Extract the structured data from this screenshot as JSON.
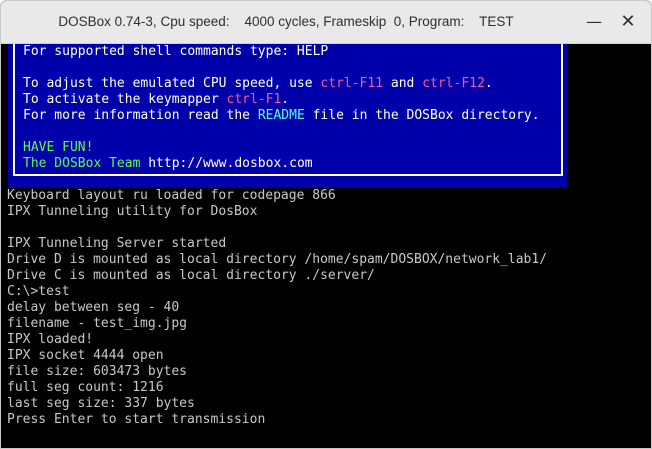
{
  "window": {
    "title": "DOSBox 0.74-3, Cpu speed:    4000 cycles, Frameskip  0, Program:    TEST",
    "minimize_glyph": "—",
    "close_glyph": "✕"
  },
  "banner": {
    "line1": "For supported shell commands type: HELP",
    "line2_a": "To adjust the emulated CPU speed, use ",
    "line2_k1": "ctrl-F11",
    "line2_b": " and ",
    "line2_k2": "ctrl-F12",
    "line2_c": ".",
    "line3_a": "To activate the keymapper ",
    "line3_k": "ctrl-F1",
    "line3_b": ".",
    "line4_a": "For more information read the ",
    "line4_k": "README",
    "line4_b": " file in the DOSBox directory.",
    "line5": "HAVE FUN!",
    "line6_a": "The DOSBox Team ",
    "line6_b": "http://www.dosbox.com"
  },
  "terminal": {
    "lines": [
      "Keyboard layout ru loaded for codepage 866",
      "IPX Tunneling utility for DosBox",
      "",
      "IPX Tunneling Server started",
      "Drive D is mounted as local directory /home/spam/DOSBOX/network_lab1/",
      "Drive C is mounted as local directory ./server/",
      "C:\\>test",
      "delay between seg - 40",
      "filename - test_img.jpg",
      "IPX loaded!",
      "IPX socket 4444 open",
      "file size: 603473 bytes",
      "full seg count: 1216",
      "last seg size: 337 bytes",
      "Press Enter to start transmission"
    ]
  },
  "colors": {
    "banner_bg": "#0000aa",
    "key_highlight": "#ff5599",
    "readme_highlight": "#55ffff",
    "fun_text": "#55ff55",
    "terminal_text": "#c8c8c8"
  }
}
